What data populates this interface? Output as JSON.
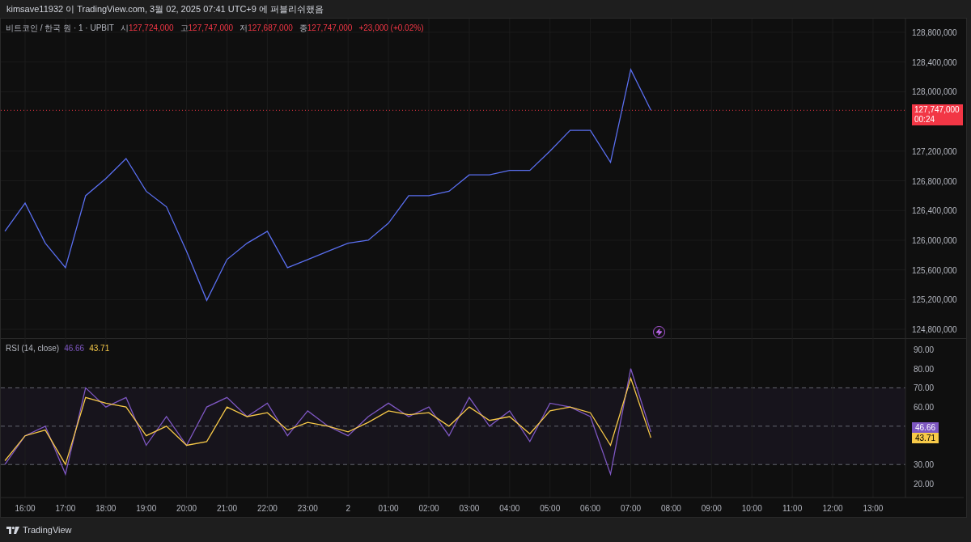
{
  "header": {
    "text": "kimsave11932 이 TradingView.com, 3월 02, 2025 07:41 UTC+9 에 퍼블리쉬했음"
  },
  "legend": {
    "symbol": "비트코인 / 한국 원 · 1 · UPBIT",
    "values": [
      {
        "label": "시",
        "value": "127,724,000"
      },
      {
        "label": "고",
        "value": "127,747,000"
      },
      {
        "label": "저",
        "value": "127,687,000"
      },
      {
        "label": "종",
        "value": "127,747,000"
      }
    ],
    "change": "+23,000 (+0.02%)"
  },
  "price_pane": {
    "last_price": "127,747,000",
    "countdown": "00:24",
    "chart_data": {
      "type": "line",
      "grid": true,
      "series": [
        {
          "color": "#5a6ff0",
          "values": [
            126120000,
            126500000,
            125960000,
            125630000,
            126600000,
            126830000,
            127100000,
            126660000,
            126450000,
            125850000,
            125190000,
            125740000,
            125960000,
            126120000,
            125630000,
            125740000,
            125850000,
            125960000,
            126000000,
            126230000,
            126600000,
            126600000,
            126660000,
            126880000,
            126880000,
            126940000,
            126940000,
            127200000,
            127480000,
            127480000,
            127050000,
            128300000,
            127750000,
            null,
            null,
            null,
            null,
            null,
            null,
            null,
            null,
            null,
            null,
            null
          ]
        }
      ],
      "ylim": [
        124670000,
        128985000
      ],
      "yticks": [
        {
          "value": 124800000,
          "label": "124,800,000"
        },
        {
          "value": 125200000,
          "label": "125,200,000"
        },
        {
          "value": 125600000,
          "label": "125,600,000"
        },
        {
          "value": 126000000,
          "label": "126,000,000"
        },
        {
          "value": 126400000,
          "label": "126,400,000"
        },
        {
          "value": 126800000,
          "label": "126,800,000"
        },
        {
          "value": 127200000,
          "label": "127,200,000"
        },
        {
          "value": 128000000,
          "label": "128,000,000"
        },
        {
          "value": 128400000,
          "label": "128,400,000"
        },
        {
          "value": 128800000,
          "label": "128,800,000"
        }
      ]
    }
  },
  "rsi_pane": {
    "title": "RSI (14, close)",
    "rsi_value": "46.66",
    "ma_value": "43.71",
    "rsi_badge": "46.66",
    "ma_badge": "43.71",
    "chart_data": {
      "type": "line",
      "grid": true,
      "categories": [
        null,
        "16:00",
        null,
        "17:00",
        null,
        "18:00",
        null,
        "19:00",
        null,
        "20:00",
        null,
        "21:00",
        null,
        "22:00",
        null,
        "23:00",
        null,
        "2",
        null,
        "01:00",
        null,
        "02:00",
        null,
        "03:00",
        null,
        "04:00",
        null,
        "05:00",
        null,
        "06:00",
        null,
        "07:00",
        null,
        "08:00",
        null,
        "09:00",
        null,
        "10:00",
        null,
        "11:00",
        null,
        "12:00",
        null,
        "13:00"
      ],
      "series": [
        {
          "color": "#7e57c2",
          "values": [
            30,
            45,
            50,
            25,
            70,
            60,
            65,
            40,
            55,
            40,
            60,
            65,
            55,
            62,
            45,
            58,
            50,
            45,
            55,
            62,
            55,
            60,
            45,
            65,
            50,
            58,
            42,
            62,
            60,
            55,
            25,
            80,
            47,
            null,
            null,
            null,
            null,
            null,
            null,
            null,
            null,
            null,
            null,
            null
          ]
        },
        {
          "color": "#f7c948",
          "values": [
            32,
            45,
            48,
            30,
            65,
            62,
            60,
            45,
            50,
            40,
            42,
            60,
            55,
            57,
            48,
            52,
            50,
            47,
            52,
            58,
            56,
            57,
            50,
            60,
            53,
            55,
            46,
            58,
            60,
            57,
            40,
            75,
            44,
            null,
            null,
            null,
            null,
            null,
            null,
            null,
            null,
            null,
            null,
            null
          ]
        }
      ],
      "ylim": [
        12.8,
        95.5
      ],
      "yticks": [
        {
          "value": 20,
          "label": "20.00"
        },
        {
          "value": 30,
          "label": "30.00"
        },
        {
          "value": 60,
          "label": "60.00"
        },
        {
          "value": 70,
          "label": "70.00"
        },
        {
          "value": 80,
          "label": "80.00"
        },
        {
          "value": 90,
          "label": "90.00"
        }
      ]
    }
  },
  "footer": {
    "logo_text": "TradingView"
  }
}
